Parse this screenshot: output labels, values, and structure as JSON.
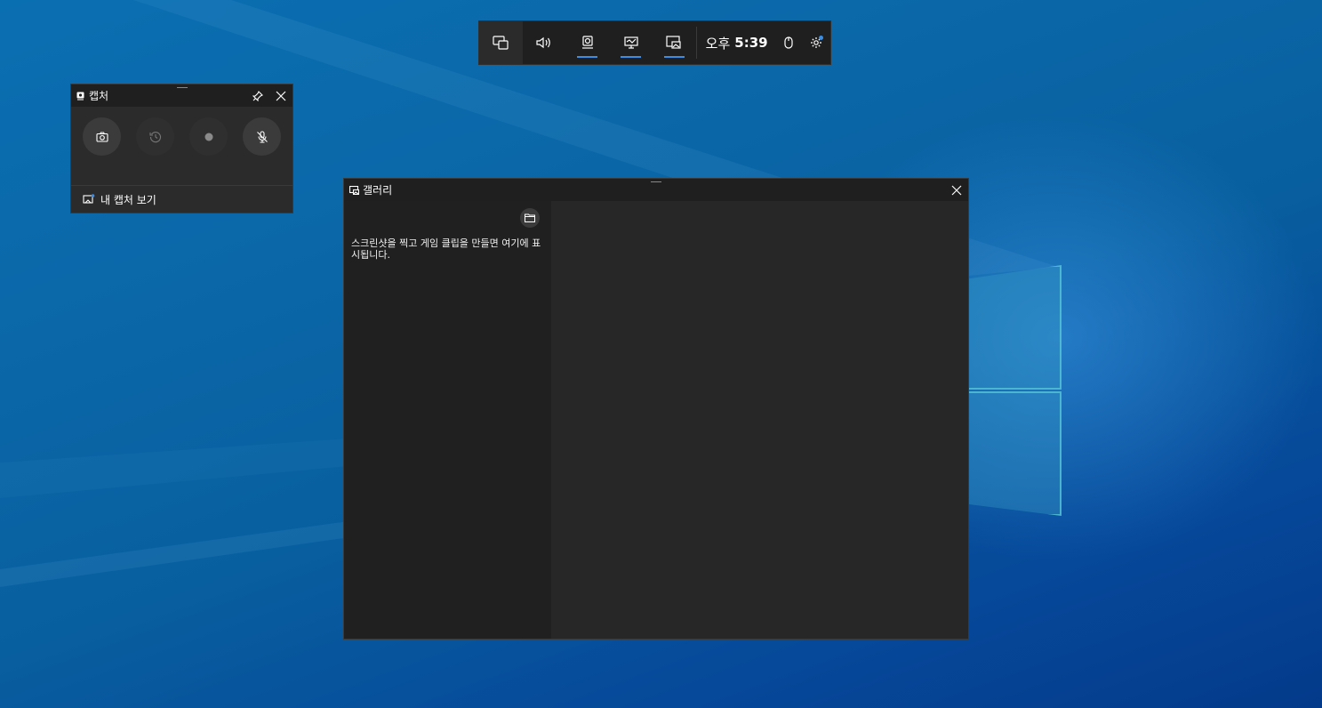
{
  "gamebar": {
    "widgets": [
      {
        "icon": "widget-menu-icon",
        "active": false
      },
      {
        "icon": "audio-icon",
        "active": false
      },
      {
        "icon": "capture-icon",
        "active": true
      },
      {
        "icon": "performance-icon",
        "active": true
      },
      {
        "icon": "gallery-icon",
        "active": true
      }
    ],
    "time_prefix": "오후",
    "time_value": "5:39",
    "mouse_icon": "mouse-icon",
    "settings_icon": "gear-icon"
  },
  "capture_widget": {
    "title": "캡처",
    "pin_icon": "pin-icon",
    "close_icon": "close-icon",
    "buttons": [
      {
        "icon": "camera-icon",
        "enabled": true
      },
      {
        "icon": "record-last-icon",
        "enabled": false
      },
      {
        "icon": "record-dot-icon",
        "enabled": false
      },
      {
        "icon": "mic-off-icon",
        "enabled": true
      }
    ],
    "footer_label": "내 캡처 보기"
  },
  "gallery": {
    "title": "갤러리",
    "close_icon": "close-icon",
    "folder_icon": "folder-icon",
    "empty_message": "스크린샷을 찍고 게임 클립을 만들면 여기에 표시됩니다."
  },
  "colors": {
    "accent": "#3a8ee6",
    "panel_dark": "#1f1f1f",
    "panel": "#2b2b2b"
  }
}
